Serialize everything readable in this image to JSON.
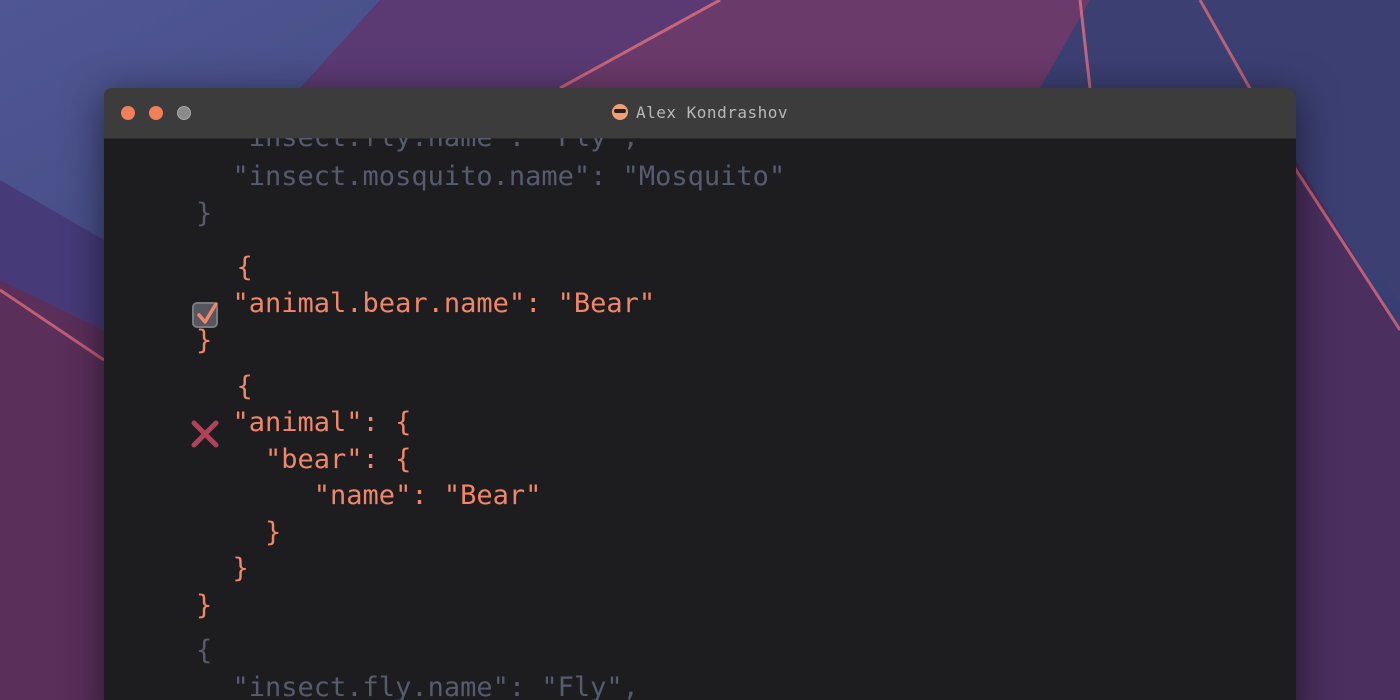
{
  "window": {
    "title": "Alex Kondrashov",
    "title_icon": "sunglasses-emoji-icon",
    "traffic_lights": [
      "close-button",
      "minimize-button",
      "zoom-button"
    ]
  },
  "colors": {
    "dim_text": "#565b70",
    "highlight_text": "#f0866a",
    "editor_bg": "#1d1d1f",
    "titlebar_bg": "#3c3c3c",
    "cross_icon": "#b0425a"
  },
  "code": {
    "lines": [
      {
        "text": "  \"insect.fly.name\": \"Fly\",",
        "tone": "dim"
      },
      {
        "text": "  \"insect.mosquito.name\": \"Mosquito\"",
        "tone": "dim"
      },
      {
        "text": "}",
        "tone": "dim"
      },
      {
        "text": "  {",
        "tone": "hot"
      },
      {
        "text": "  \"animal.bear.name\": \"Bear\"",
        "tone": "hot"
      },
      {
        "text": "}",
        "tone": "hot"
      },
      {
        "text": "  {",
        "tone": "hot"
      },
      {
        "text": "  \"animal\": {",
        "tone": "hot"
      },
      {
        "text": "    \"bear\": {",
        "tone": "hot"
      },
      {
        "text": "       \"name\": \"Bear\"",
        "tone": "hot"
      },
      {
        "text": "    }",
        "tone": "hot"
      },
      {
        "text": "  }",
        "tone": "hot"
      },
      {
        "text": "}",
        "tone": "hot"
      },
      {
        "text": "{",
        "tone": "dim"
      },
      {
        "text": "  \"insect.fly.name\": \"Fly\",",
        "tone": "dim"
      }
    ],
    "markers": {
      "correct": "checkbox-checked-icon",
      "incorrect": "cross-mark-icon"
    }
  }
}
